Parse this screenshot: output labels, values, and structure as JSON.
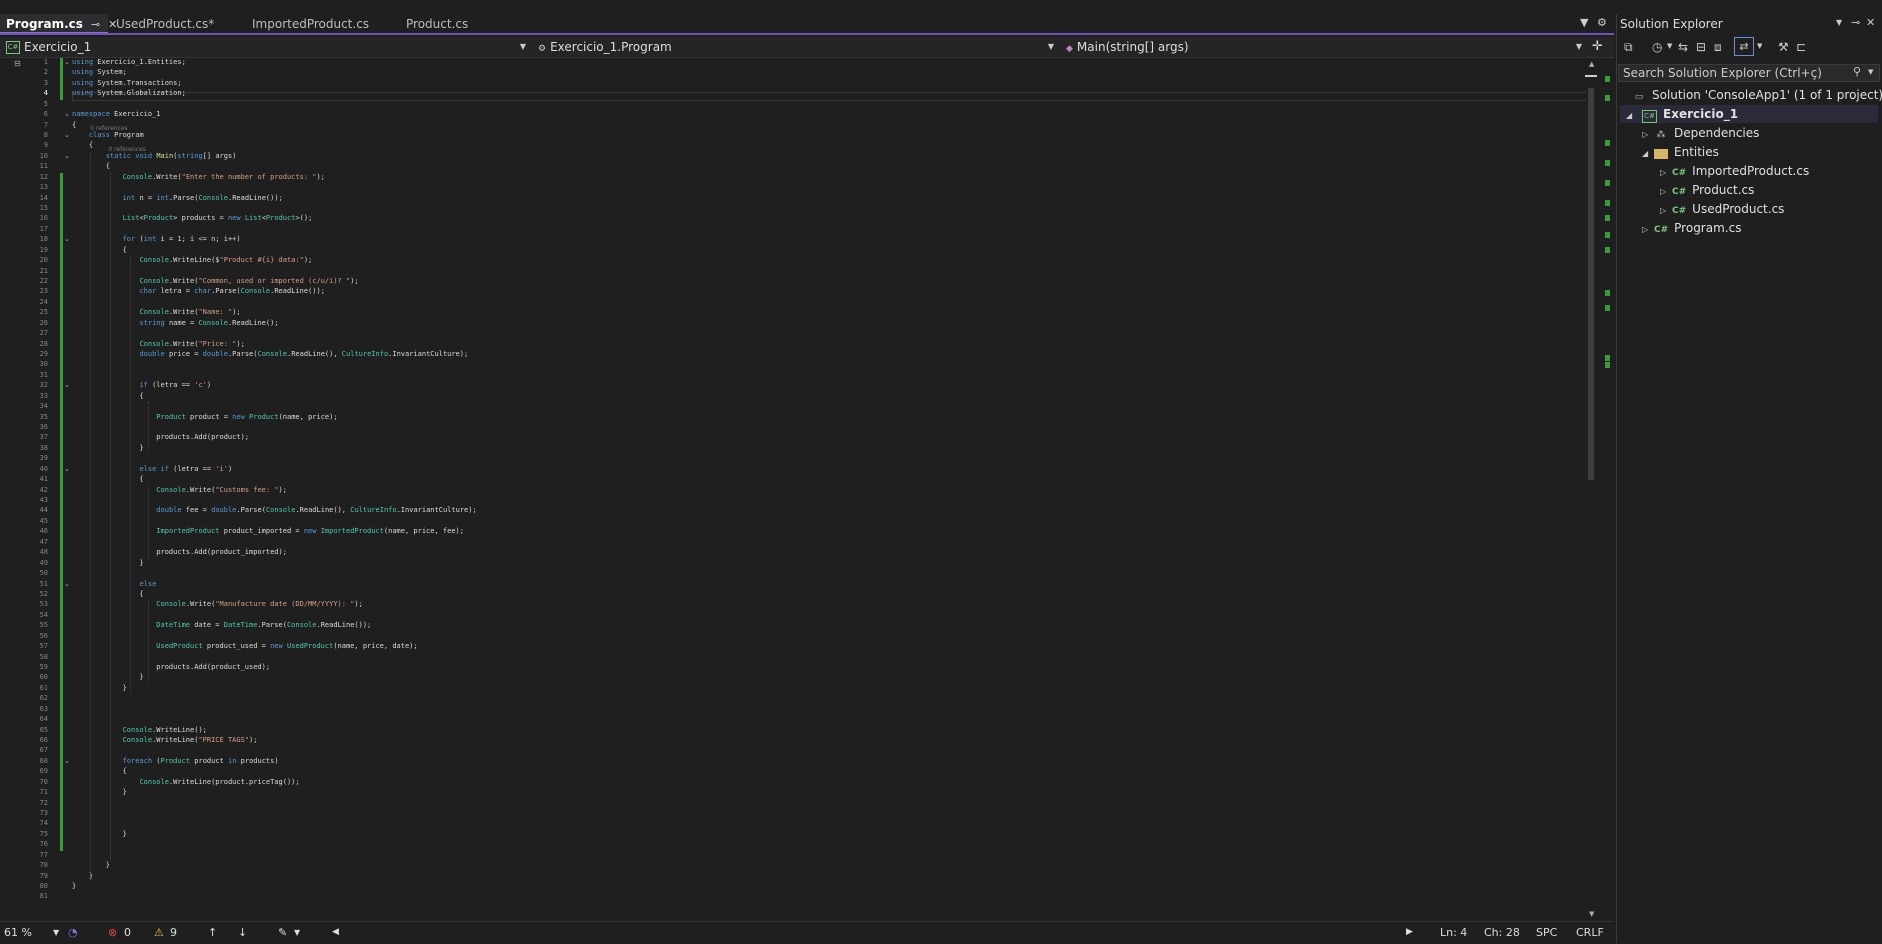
{
  "tabs": [
    {
      "label": "Program.cs",
      "active": true
    },
    {
      "label": "UsedProduct.cs*",
      "active": false
    },
    {
      "label": "ImportedProduct.cs",
      "active": false
    },
    {
      "label": "Product.cs",
      "active": false
    }
  ],
  "nav": {
    "project": "Exercicio_1",
    "class": "Exercicio_1.Program",
    "member": "Main(string[] args)"
  },
  "code_lines": [
    "using Exercicio_1.Entities;",
    "using System;",
    "using System.Transactions;",
    "using System.Globalization;",
    "",
    "namespace Exercicio_1",
    "{",
    "    class Program",
    "    {",
    "        static void Main(string[] args)",
    "        {",
    "            Console.Write(\"Enter the number of products: \");",
    "",
    "            int n = int.Parse(Console.ReadLine());",
    "",
    "            List<Product> products = new List<Product>();",
    "",
    "            for (int i = 1; i <= n; i++)",
    "            {",
    "                Console.WriteLine($\"Product #{i} data:\");",
    "",
    "                Console.Write(\"Common, used or imported (c/u/i)? \");",
    "                char letra = char.Parse(Console.ReadLine());",
    "",
    "                Console.Write(\"Name: \");",
    "                string name = Console.ReadLine();",
    "",
    "                Console.Write(\"Price: \");",
    "                double price = double.Parse(Console.ReadLine(), CultureInfo.InvariantCulture);",
    "",
    "",
    "                if (letra == 'c')",
    "                {",
    "",
    "                    Product product = new Product(name, price);",
    "",
    "                    products.Add(product);",
    "                }",
    "",
    "                else if (letra == 'i')",
    "                {",
    "                    Console.Write(\"Customs fee: \");",
    "",
    "                    double fee = double.Parse(Console.ReadLine(), CultureInfo.InvariantCulture);",
    "",
    "                    ImportedProduct product_imported = new ImportedProduct(name, price, fee);",
    "",
    "                    products.Add(product_imported);",
    "                }",
    "",
    "                else",
    "                {",
    "                    Console.Write(\"Manufacture date (DD/MM/YYYY): \");",
    "",
    "                    DateTime date = DateTime.Parse(Console.ReadLine());",
    "",
    "                    UsedProduct product_used = new UsedProduct(name, price, date);",
    "",
    "                    products.Add(product_used);",
    "                }",
    "            }",
    "",
    "",
    "",
    "            Console.WriteLine();",
    "            Console.WriteLine(\"PRICE TAGS\");",
    "",
    "            foreach (Product product in products)",
    "            {",
    "                Console.WriteLine(product.priceTag());",
    "            }",
    "",
    "",
    "",
    "            }",
    "",
    "",
    "        }",
    "    }",
    "}",
    ""
  ],
  "references_label": "0 references",
  "status": {
    "zoom": "61 %",
    "errors": "0",
    "warnings": "9",
    "ln": "Ln: 4",
    "ch": "Ch: 28",
    "spc": "SPC",
    "crlf": "CRLF"
  },
  "solution_explorer": {
    "title": "Solution Explorer",
    "search_placeholder": "Search Solution Explorer (Ctrl+ç)",
    "solution": "Solution 'ConsoleApp1' (1 of 1 project)",
    "project": "Exercicio_1",
    "dependencies": "Dependencies",
    "entities": "Entities",
    "files": [
      "ImportedProduct.cs",
      "Product.cs",
      "UsedProduct.cs"
    ],
    "program": "Program.cs"
  }
}
